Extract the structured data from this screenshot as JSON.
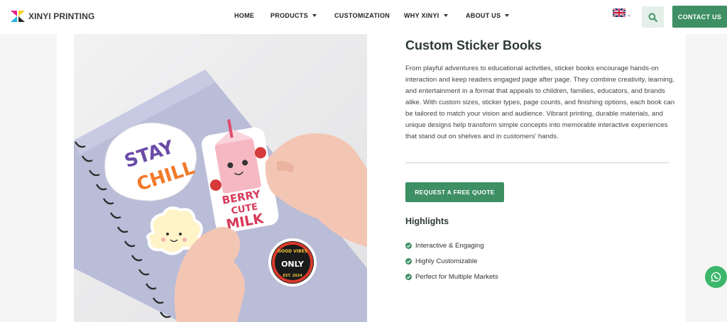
{
  "brand": {
    "name": "XINYI PRINTING"
  },
  "nav": {
    "items": [
      {
        "label": "HOME",
        "has_dropdown": false
      },
      {
        "label": "PRODUCTS",
        "has_dropdown": true
      },
      {
        "label": "CUSTOMIZATION",
        "has_dropdown": false
      },
      {
        "label": "WHY XINYI",
        "has_dropdown": true
      },
      {
        "label": "ABOUT US",
        "has_dropdown": true
      }
    ],
    "contact_label": "CONTACT US",
    "language_icon": "uk-flag-icon",
    "search_icon": "search-icon"
  },
  "product": {
    "title": "Custom Sticker Books",
    "description": "From playful adventures to educational activities, sticker books encourage hands-on interaction and keep readers engaged page after page. They combine creativity, learning, and entertainment in a format that appeals to children, families, educators, and brands alike. With custom sizes, sticker types, page counts, and finishing options, each book can be tailored to match your vision and audience. Vibrant printing, durable materials, and unique designs help transform simple concepts into memorable interactive experiences that stand out on shelves and in customers' hands.",
    "cta_label": "REQUEST A FREE QUOTE",
    "highlights_title": "Highlights",
    "highlights": [
      "Interactive & Engaging",
      "Highly Customizable",
      "Perfect for Multiple Markets"
    ]
  },
  "image": {
    "stickers": {
      "stay_chill_line1": "STAY",
      "stay_chill_line2": "CHILL",
      "milk_line1": "BERRY",
      "milk_line2": "CUTE",
      "milk_line3": "MILK",
      "badge_top": "GOOD VIBES",
      "badge_mid": "ONLY",
      "badge_bottom": "EST. 2024"
    }
  },
  "colors": {
    "accent": "#3e8f64",
    "heading": "#2d3a35",
    "whatsapp": "#3cb66b"
  },
  "floating": {
    "whatsapp_icon": "whatsapp-icon"
  }
}
